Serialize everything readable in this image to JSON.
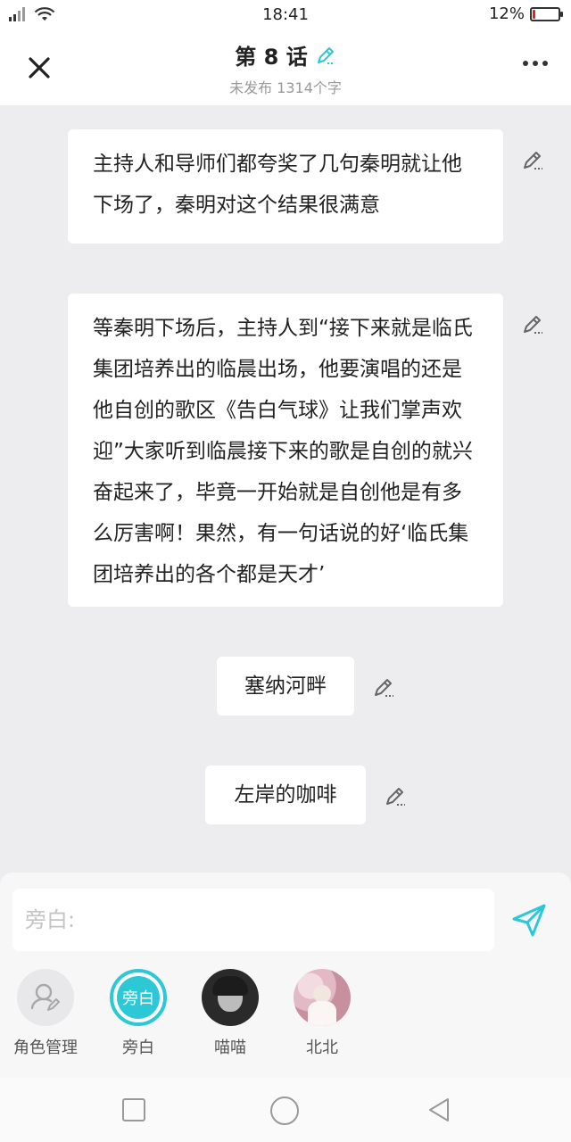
{
  "status_bar": {
    "time": "18:41",
    "battery": "12%",
    "battery_level": 0.12
  },
  "header": {
    "title": "第 8 话",
    "subtitle": "未发布 1314个字"
  },
  "messages": [
    {
      "text": "主持人和导师们都夸奖了几句秦明就让他下场了，秦明对这个结果很满意"
    },
    {
      "text": "等秦明下场后，主持人到“接下来就是临氏集团培养出的临晨出场，他要演唱的还是他自创的歌区《告白气球》让我们掌声欢迎”大家听到临晨接下来的歌是自创的就兴奋起来了，毕竟一开始就是自创他是有多么厉害啊！果然，有一句话说的好‘临氏集团培养出的各个都是天才’"
    },
    {
      "text": "塞纳河畔"
    },
    {
      "text": "左岸的咖啡"
    }
  ],
  "input": {
    "placeholder": "旁白:"
  },
  "roles": [
    {
      "label": "角色管理"
    },
    {
      "label": "旁白",
      "badge": "旁白"
    },
    {
      "label": "喵喵"
    },
    {
      "label": "北北"
    }
  ],
  "colors": {
    "accent": "#2cc8d6",
    "background": "#ededf0",
    "battery_low": "#e0241b"
  },
  "icons": {
    "close": "close-icon",
    "more": "more-icon",
    "edit": "pencil-icon",
    "send": "send-icon"
  }
}
